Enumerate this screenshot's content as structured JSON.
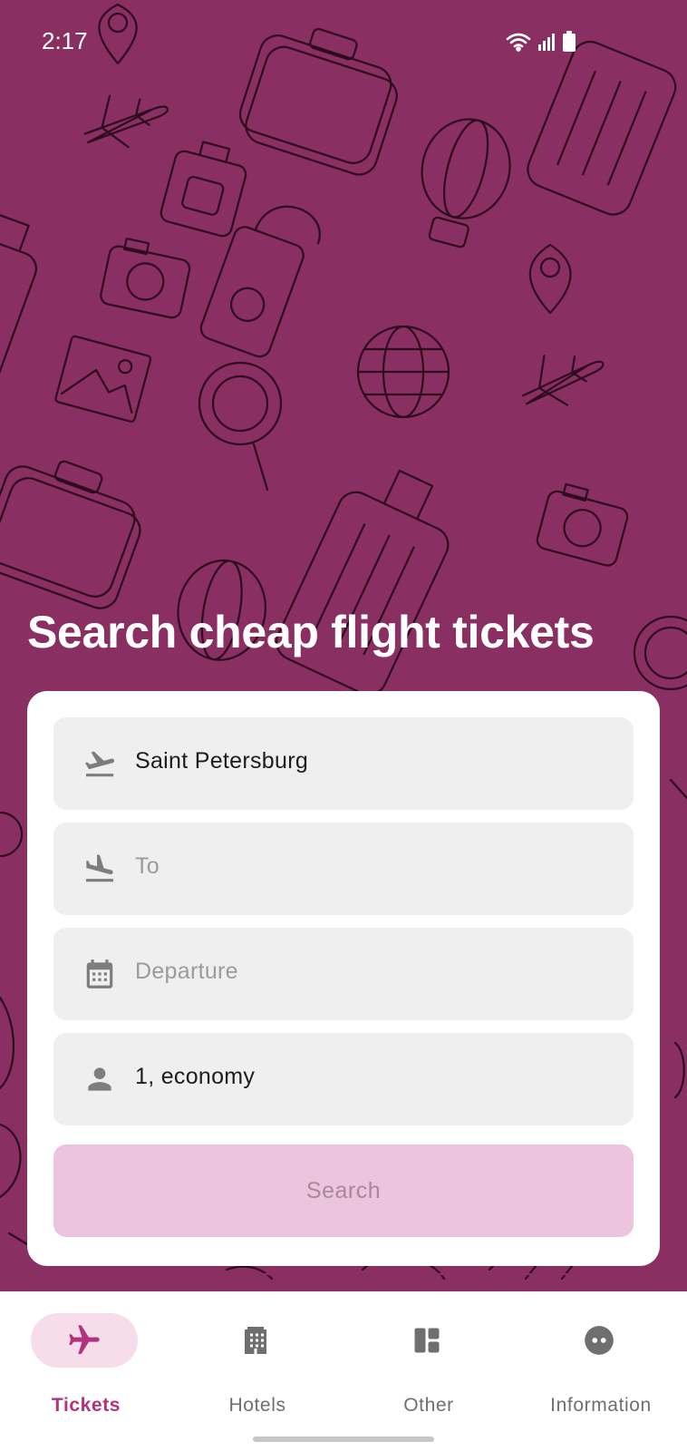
{
  "status_bar": {
    "time": "2:17"
  },
  "headline": "Search cheap flight tickets",
  "form": {
    "from": {
      "value": "Saint Petersburg",
      "icon": "flight-takeoff-icon"
    },
    "to": {
      "placeholder": "To",
      "icon": "flight-land-icon"
    },
    "departure": {
      "placeholder": "Departure",
      "icon": "calendar-icon"
    },
    "passengers": {
      "value": "1, economy",
      "icon": "person-icon"
    },
    "search_label": "Search"
  },
  "bottom_nav": {
    "items": [
      {
        "label": "Tickets",
        "icon": "airplane-icon",
        "active": true
      },
      {
        "label": "Hotels",
        "icon": "hotel-building-icon",
        "active": false
      },
      {
        "label": "Other",
        "icon": "dashboard-icon",
        "active": false
      },
      {
        "label": "Information",
        "icon": "info-face-icon",
        "active": false
      }
    ]
  },
  "colors": {
    "hero_background": "#8a2f61",
    "accent": "#b3317d",
    "search_button_disabled": "#ecc4de",
    "field_background": "#efefef"
  }
}
